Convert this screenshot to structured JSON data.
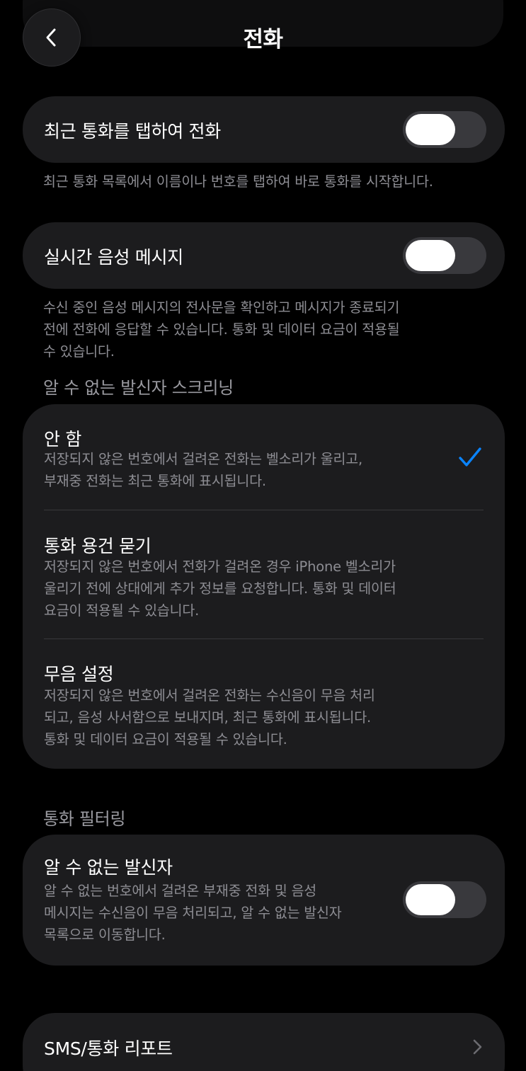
{
  "header": {
    "title": "전화",
    "back_icon": "chevron-left-icon"
  },
  "tap_recent": {
    "label": "최근 통화를 탭하여 전화",
    "enabled": false,
    "footnote": "최근 통화 목록에서 이름이나 번호를 탭하여 바로 통화를 시작합니다."
  },
  "live_voicemail": {
    "label": "실시간 음성 메시지",
    "enabled": false,
    "footnote_lines": [
      "수신 중인 음성 메시지의 전사문을 확인하고 메시지가 종료되기",
      "전에 전화에 응답할 수 있습니다. 통화 및 데이터 요금이 적용될",
      "수 있습니다."
    ]
  },
  "screening": {
    "header": "알 수 없는 발신자 스크리닝",
    "options": [
      {
        "title": "안 함",
        "desc_lines": [
          "저장되지 않은 번호에서 걸려온 전화는 벨소리가 울리고,",
          "부재중 전화는 최근 통화에 표시됩니다."
        ],
        "selected": true
      },
      {
        "title": "통화 용건 묻기",
        "desc_lines": [
          "저장되지 않은 번호에서 전화가 걸려온 경우 iPhone 벨소리가",
          "울리기 전에 상대에게 추가 정보를 요청합니다. 통화 및 데이터",
          "요금이 적용될 수 있습니다."
        ],
        "selected": false
      },
      {
        "title": "무음 설정",
        "desc_lines": [
          "저장되지 않은 번호에서 걸려온 전화는 수신음이 무음 처리",
          "되고, 음성 사서함으로 보내지며, 최근 통화에 표시됩니다.",
          "통화 및 데이터 요금이 적용될 수 있습니다."
        ],
        "selected": false
      }
    ],
    "check_icon": "checkmark-icon"
  },
  "filtering": {
    "header": "통화 필터링",
    "unknown": {
      "title": "알 수 없는 발신자",
      "enabled": false,
      "desc_lines": [
        "알 수 없는 번호에서 걸려온 부재중 전화 및 음성",
        "메시지는 수신음이 무음 처리되고, 알 수 없는 발신자",
        "목록으로 이동합니다."
      ]
    }
  },
  "sms_report": {
    "label": "SMS/통화 리포트",
    "chevron_icon": "chevron-right-icon"
  },
  "colors": {
    "background": "#000000",
    "card": "#1c1c1e",
    "secondary_text": "#8d8d93",
    "accent": "#0a84ff",
    "toggle_off": "#39393d"
  }
}
